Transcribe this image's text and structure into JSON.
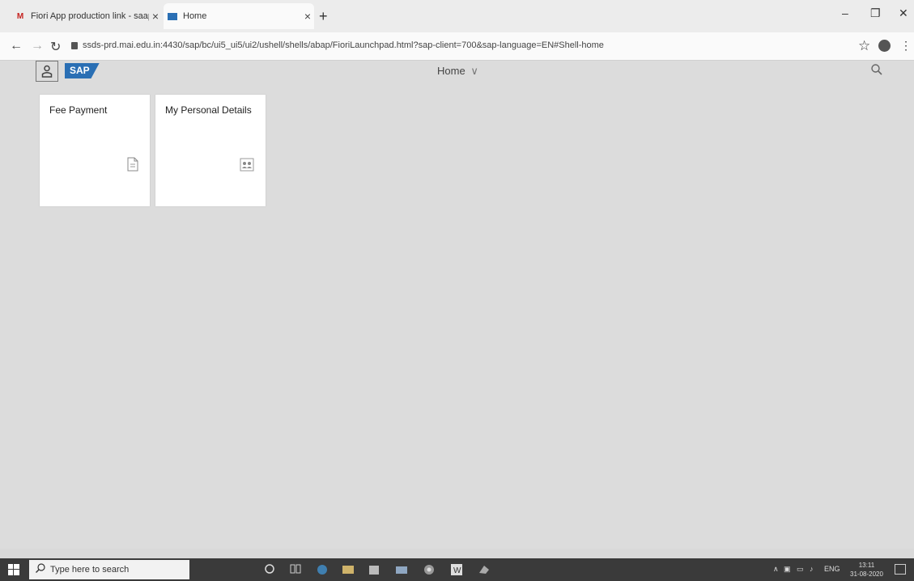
{
  "browser": {
    "tabs": [
      {
        "title": "Fiori App production link - saap",
        "favicon": "gmail-icon",
        "active": false
      },
      {
        "title": "Home",
        "favicon": "sap-icon",
        "active": true
      }
    ],
    "new_tab_label": "+",
    "close_label": "×",
    "url": "ssds-prd.mai.edu.in:4430/sap/bc/ui5_ui5/ui2/ushell/shells/abap/FioriLaunchpad.html?sap-client=700&sap-language=EN#Shell-home",
    "window_controls": {
      "minimize": "–",
      "restore": "❐",
      "close": "✕"
    }
  },
  "shell": {
    "logo_text": "SAP",
    "title": "Home",
    "title_chevron": "∨",
    "accent_color": "#2a6fb4"
  },
  "tiles": [
    {
      "title": "Fee Payment",
      "icon": "document-icon"
    },
    {
      "title": "My Personal Details",
      "icon": "personal-details-icon"
    }
  ],
  "taskbar": {
    "search_placeholder": "Type here to search",
    "language": "ENG",
    "time": "13:11",
    "date": "31-08-2020"
  }
}
